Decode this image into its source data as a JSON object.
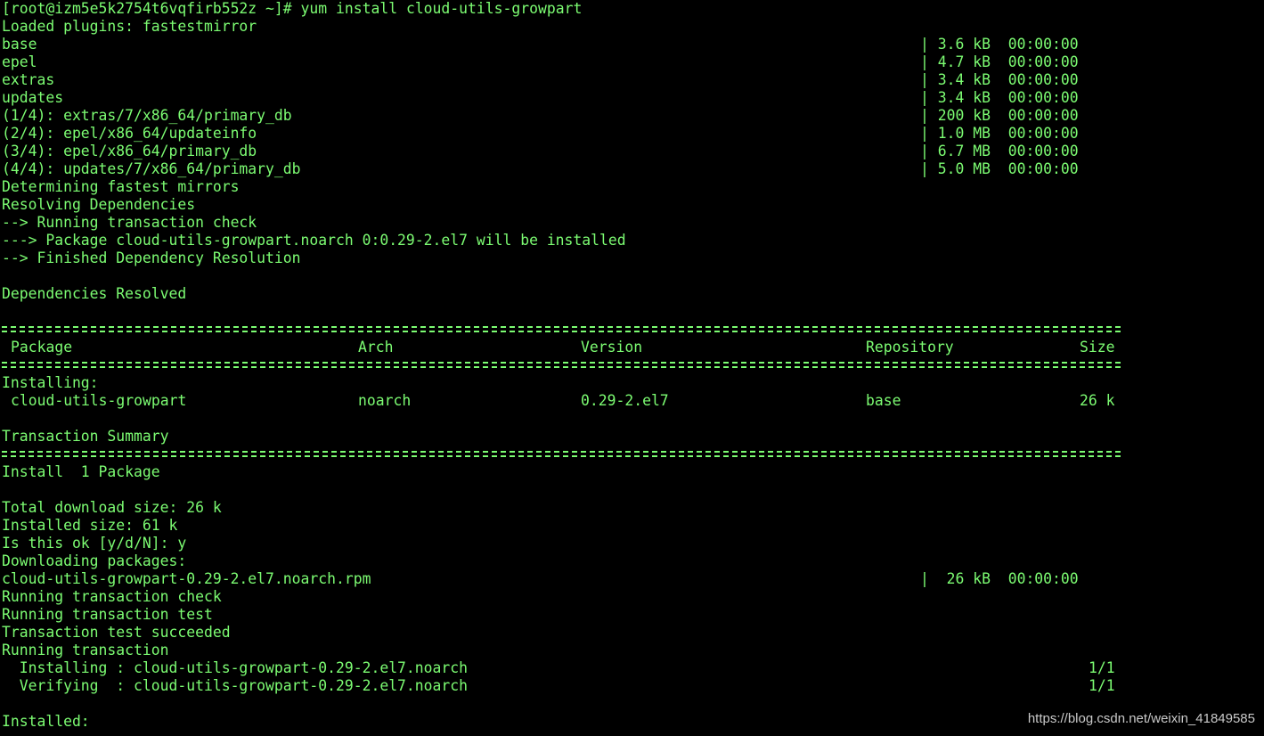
{
  "prompt": {
    "user_host": "[root@izm5e5k2754t6vqfirb552z ~]#",
    "command": "yum install cloud-utils-growpart"
  },
  "plugins_line": "Loaded plugins: fastestmirror",
  "repos": [
    {
      "name": "base",
      "size": "| 3.6 kB",
      "time": "00:00:00"
    },
    {
      "name": "epel",
      "size": "| 4.7 kB",
      "time": "00:00:00"
    },
    {
      "name": "extras",
      "size": "| 3.4 kB",
      "time": "00:00:00"
    },
    {
      "name": "updates",
      "size": "| 3.4 kB",
      "time": "00:00:00"
    },
    {
      "name": "(1/4): extras/7/x86_64/primary_db",
      "size": "| 200 kB",
      "time": "00:00:00"
    },
    {
      "name": "(2/4): epel/x86_64/updateinfo",
      "size": "| 1.0 MB",
      "time": "00:00:00"
    },
    {
      "name": "(3/4): epel/x86_64/primary_db",
      "size": "| 6.7 MB",
      "time": "00:00:00"
    },
    {
      "name": "(4/4): updates/7/x86_64/primary_db",
      "size": "| 5.0 MB",
      "time": "00:00:00"
    }
  ],
  "resolve_lines": [
    "Determining fastest mirrors",
    "Resolving Dependencies",
    "--> Running transaction check",
    "---> Package cloud-utils-growpart.noarch 0:0.29-2.el7 will be installed",
    "--> Finished Dependency Resolution"
  ],
  "deps_resolved": "Dependencies Resolved",
  "table": {
    "headers": {
      "package": "Package",
      "arch": "Arch",
      "version": "Version",
      "repository": "Repository",
      "size": "Size"
    },
    "section_label": "Installing:",
    "row": {
      "package": "cloud-utils-growpart",
      "arch": "noarch",
      "version": "0.29-2.el7",
      "repository": "base",
      "size": "26 k"
    }
  },
  "summary": {
    "title": "Transaction Summary",
    "install_line": "Install  1 Package",
    "total_download": "Total download size: 26 k",
    "installed_size": "Installed size: 61 k",
    "confirm": "Is this ok [y/d/N]: y",
    "downloading": "Downloading packages:",
    "download_file": {
      "name": "cloud-utils-growpart-0.29-2.el7.noarch.rpm",
      "size": "|  26 kB",
      "time": "00:00:00"
    }
  },
  "transaction_lines": [
    "Running transaction check",
    "Running transaction test",
    "Transaction test succeeded",
    "Running transaction"
  ],
  "steps": [
    {
      "label": "  Installing : cloud-utils-growpart-0.29-2.el7.noarch",
      "count": "1/1"
    },
    {
      "label": "  Verifying  : cloud-utils-growpart-0.29-2.el7.noarch",
      "count": "1/1"
    }
  ],
  "installed_label": "Installed:",
  "watermark": "https://blog.csdn.net/weixin_41849585",
  "colors": {
    "text": "#7CFC72",
    "background": "#000000"
  }
}
